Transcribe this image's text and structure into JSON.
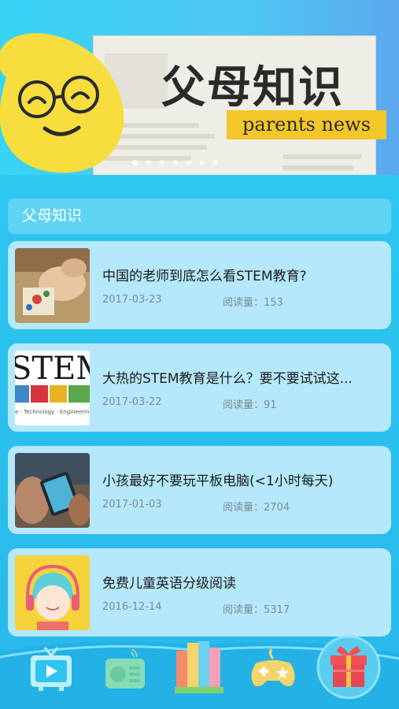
{
  "banner": {
    "title": "父母知识",
    "subtitle": "parents news",
    "slides": 7,
    "active_slide": 1
  },
  "section": {
    "title": "父母知识"
  },
  "articles": [
    {
      "title": "中国的老师到底怎么看STEM教育?",
      "date": "2017-03-23",
      "views": "阅读量：153",
      "thumb": "kids-crafting-photo"
    },
    {
      "title": "大热的STEM教育是什么？要不要试试这...",
      "date": "2017-03-22",
      "views": "阅读量：91",
      "thumb": "stem-logo-image"
    },
    {
      "title": "小孩最好不要玩平板电脑(<1小时每天)",
      "date": "2017-01-03",
      "views": "阅读量：2704",
      "thumb": "child-tablet-photo"
    },
    {
      "title": "免费儿童英语分级阅读",
      "date": "2016-12-14",
      "views": "阅读量：5317",
      "thumb": "cartoon-child-headphones"
    }
  ],
  "stem_logo_text": "STEM",
  "stem_logo_caption": "e · Technology · Engineering",
  "nav": [
    {
      "name": "tv-icon",
      "color": "#bfeefc"
    },
    {
      "name": "radio-icon",
      "color": "#86dcb7"
    },
    {
      "name": "books-icon",
      "color": "#f28b6b"
    },
    {
      "name": "gamepad-icon",
      "color": "#f5d56a"
    },
    {
      "name": "gift-icon",
      "color": "#f0525a"
    }
  ],
  "colors": {
    "background": "#2bc3ef",
    "card": "#b4e8fa",
    "section_header": "#5fd3f4",
    "banner_tag": "#f3c62a",
    "mascot": "#f7dd3e"
  }
}
